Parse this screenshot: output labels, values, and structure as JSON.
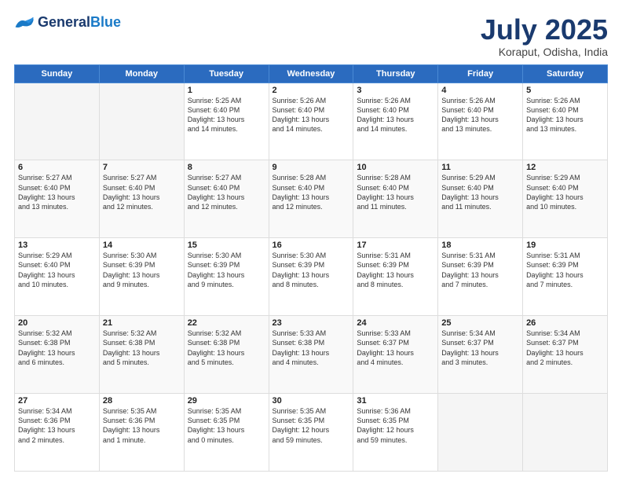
{
  "header": {
    "logo_general": "General",
    "logo_blue": "Blue",
    "month_title": "July 2025",
    "location": "Koraput, Odisha, India"
  },
  "days_of_week": [
    "Sunday",
    "Monday",
    "Tuesday",
    "Wednesday",
    "Thursday",
    "Friday",
    "Saturday"
  ],
  "weeks": [
    [
      {
        "day": "",
        "info": ""
      },
      {
        "day": "",
        "info": ""
      },
      {
        "day": "1",
        "info": "Sunrise: 5:25 AM\nSunset: 6:40 PM\nDaylight: 13 hours\nand 14 minutes."
      },
      {
        "day": "2",
        "info": "Sunrise: 5:26 AM\nSunset: 6:40 PM\nDaylight: 13 hours\nand 14 minutes."
      },
      {
        "day": "3",
        "info": "Sunrise: 5:26 AM\nSunset: 6:40 PM\nDaylight: 13 hours\nand 14 minutes."
      },
      {
        "day": "4",
        "info": "Sunrise: 5:26 AM\nSunset: 6:40 PM\nDaylight: 13 hours\nand 13 minutes."
      },
      {
        "day": "5",
        "info": "Sunrise: 5:26 AM\nSunset: 6:40 PM\nDaylight: 13 hours\nand 13 minutes."
      }
    ],
    [
      {
        "day": "6",
        "info": "Sunrise: 5:27 AM\nSunset: 6:40 PM\nDaylight: 13 hours\nand 13 minutes."
      },
      {
        "day": "7",
        "info": "Sunrise: 5:27 AM\nSunset: 6:40 PM\nDaylight: 13 hours\nand 12 minutes."
      },
      {
        "day": "8",
        "info": "Sunrise: 5:27 AM\nSunset: 6:40 PM\nDaylight: 13 hours\nand 12 minutes."
      },
      {
        "day": "9",
        "info": "Sunrise: 5:28 AM\nSunset: 6:40 PM\nDaylight: 13 hours\nand 12 minutes."
      },
      {
        "day": "10",
        "info": "Sunrise: 5:28 AM\nSunset: 6:40 PM\nDaylight: 13 hours\nand 11 minutes."
      },
      {
        "day": "11",
        "info": "Sunrise: 5:29 AM\nSunset: 6:40 PM\nDaylight: 13 hours\nand 11 minutes."
      },
      {
        "day": "12",
        "info": "Sunrise: 5:29 AM\nSunset: 6:40 PM\nDaylight: 13 hours\nand 10 minutes."
      }
    ],
    [
      {
        "day": "13",
        "info": "Sunrise: 5:29 AM\nSunset: 6:40 PM\nDaylight: 13 hours\nand 10 minutes."
      },
      {
        "day": "14",
        "info": "Sunrise: 5:30 AM\nSunset: 6:39 PM\nDaylight: 13 hours\nand 9 minutes."
      },
      {
        "day": "15",
        "info": "Sunrise: 5:30 AM\nSunset: 6:39 PM\nDaylight: 13 hours\nand 9 minutes."
      },
      {
        "day": "16",
        "info": "Sunrise: 5:30 AM\nSunset: 6:39 PM\nDaylight: 13 hours\nand 8 minutes."
      },
      {
        "day": "17",
        "info": "Sunrise: 5:31 AM\nSunset: 6:39 PM\nDaylight: 13 hours\nand 8 minutes."
      },
      {
        "day": "18",
        "info": "Sunrise: 5:31 AM\nSunset: 6:39 PM\nDaylight: 13 hours\nand 7 minutes."
      },
      {
        "day": "19",
        "info": "Sunrise: 5:31 AM\nSunset: 6:39 PM\nDaylight: 13 hours\nand 7 minutes."
      }
    ],
    [
      {
        "day": "20",
        "info": "Sunrise: 5:32 AM\nSunset: 6:38 PM\nDaylight: 13 hours\nand 6 minutes."
      },
      {
        "day": "21",
        "info": "Sunrise: 5:32 AM\nSunset: 6:38 PM\nDaylight: 13 hours\nand 5 minutes."
      },
      {
        "day": "22",
        "info": "Sunrise: 5:32 AM\nSunset: 6:38 PM\nDaylight: 13 hours\nand 5 minutes."
      },
      {
        "day": "23",
        "info": "Sunrise: 5:33 AM\nSunset: 6:38 PM\nDaylight: 13 hours\nand 4 minutes."
      },
      {
        "day": "24",
        "info": "Sunrise: 5:33 AM\nSunset: 6:37 PM\nDaylight: 13 hours\nand 4 minutes."
      },
      {
        "day": "25",
        "info": "Sunrise: 5:34 AM\nSunset: 6:37 PM\nDaylight: 13 hours\nand 3 minutes."
      },
      {
        "day": "26",
        "info": "Sunrise: 5:34 AM\nSunset: 6:37 PM\nDaylight: 13 hours\nand 2 minutes."
      }
    ],
    [
      {
        "day": "27",
        "info": "Sunrise: 5:34 AM\nSunset: 6:36 PM\nDaylight: 13 hours\nand 2 minutes."
      },
      {
        "day": "28",
        "info": "Sunrise: 5:35 AM\nSunset: 6:36 PM\nDaylight: 13 hours\nand 1 minute."
      },
      {
        "day": "29",
        "info": "Sunrise: 5:35 AM\nSunset: 6:35 PM\nDaylight: 13 hours\nand 0 minutes."
      },
      {
        "day": "30",
        "info": "Sunrise: 5:35 AM\nSunset: 6:35 PM\nDaylight: 12 hours\nand 59 minutes."
      },
      {
        "day": "31",
        "info": "Sunrise: 5:36 AM\nSunset: 6:35 PM\nDaylight: 12 hours\nand 59 minutes."
      },
      {
        "day": "",
        "info": ""
      },
      {
        "day": "",
        "info": ""
      }
    ]
  ]
}
